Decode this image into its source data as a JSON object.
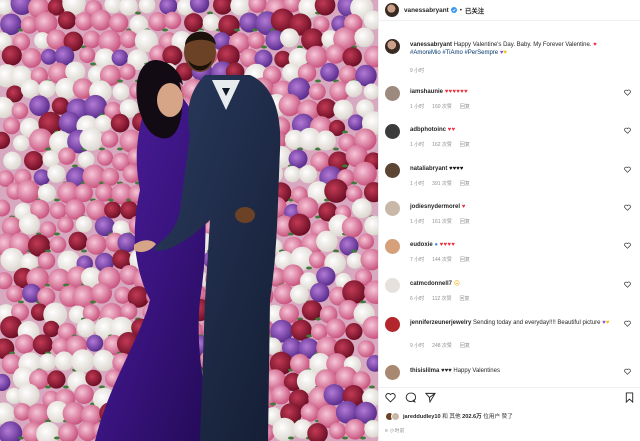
{
  "header": {
    "username": "vanessabryant",
    "dot": "•",
    "follow_label": "已关注"
  },
  "caption": {
    "username": "vanessabryant",
    "text": "Happy Valentine's Day. Baby. My Forever Valentine.",
    "tags": "#AmoreMio #TiAmo #PerSempre",
    "time": "9 小时"
  },
  "comments": [
    {
      "username": "iamshaunie",
      "text": "♥♥♥♥♥♥",
      "time": "1 小时",
      "likes": "160 次赞",
      "reply": "回复"
    },
    {
      "username": "adbphotoinc",
      "text": "♥♥",
      "time": "1 小时",
      "likes": "162 次赞",
      "reply": "回复"
    },
    {
      "username": "nataliabryant",
      "text": "♥♥♥♥",
      "time": "1 小时",
      "likes": "391 次赞",
      "reply": "回复"
    },
    {
      "username": "jodiesnydermorel",
      "text": "♥",
      "time": "1 小时",
      "likes": "161 次赞",
      "reply": "回复"
    },
    {
      "username": "eudoxie",
      "text": "♥♥♥♥",
      "time": "7 小时",
      "likes": "144 次赞",
      "reply": "回复"
    },
    {
      "username": "catmcdonnell7",
      "text": "",
      "time": "6 小时",
      "likes": "112 次赞",
      "reply": "回复"
    },
    {
      "username": "jenniferzeunerjewelry",
      "text": "Sending  today and everyday!!!! Beautiful picture",
      "time": "9 小时",
      "likes": "248 次赞",
      "reply": "回复"
    },
    {
      "username": "thisislilma",
      "text": "♥♥♥  Happy Valentines",
      "time": "",
      "likes": "",
      "reply": ""
    }
  ],
  "likes": {
    "prefix": "",
    "user": "jareddudley10",
    "connector": "和",
    "others_label": "其他",
    "count": "202.6万",
    "suffix": "位用户 赞了"
  },
  "post_time": "9 小时前",
  "colors": {
    "heart_red": "#ed2e40",
    "link_blue": "#00376b",
    "muted": "#8e8e8e",
    "text": "#262626"
  }
}
